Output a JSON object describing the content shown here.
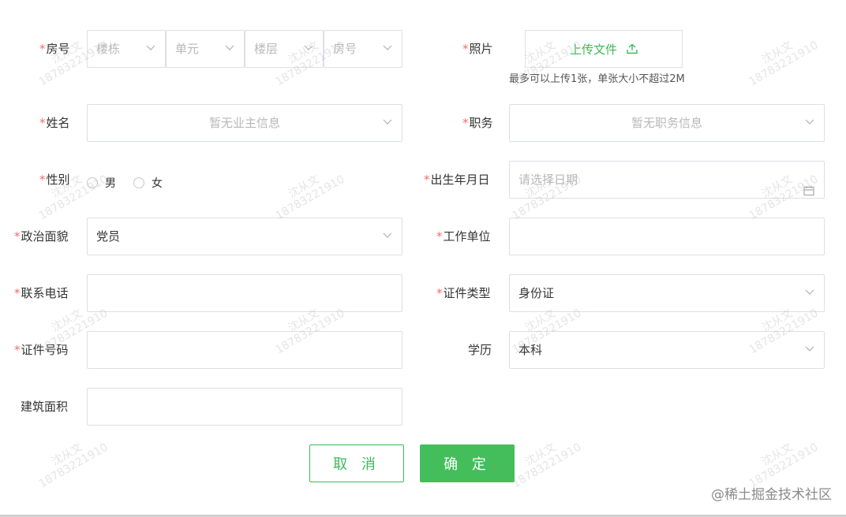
{
  "form": {
    "room": {
      "label": "房号",
      "required": "*",
      "selects": [
        {
          "placeholder": "楼栋"
        },
        {
          "placeholder": "单元"
        },
        {
          "placeholder": "楼层"
        },
        {
          "placeholder": "房号"
        }
      ]
    },
    "photo": {
      "label": "照片",
      "required": "*",
      "upload_label": "上传文件",
      "hint": "最多可以上传1张，单张大小不超过2M"
    },
    "name": {
      "label": "姓名",
      "required": "*",
      "placeholder": "暂无业主信息"
    },
    "position": {
      "label": "职务",
      "required": "*",
      "placeholder": "暂无职务信息"
    },
    "gender": {
      "label": "性别",
      "required": "*",
      "options": [
        "男",
        "女"
      ]
    },
    "birthday": {
      "label": "出生年月日",
      "required": "*",
      "placeholder": "请选择日期"
    },
    "politics": {
      "label": "政治面貌",
      "required": "*",
      "value": "党员"
    },
    "workplace": {
      "label": "工作单位",
      "required": "*",
      "value": ""
    },
    "phone": {
      "label": "联系电话",
      "required": "*",
      "value": ""
    },
    "id_type": {
      "label": "证件类型",
      "required": "*",
      "value": "身份证"
    },
    "id_number": {
      "label": "证件号码",
      "required": "*",
      "value": ""
    },
    "education": {
      "label": "学历",
      "value": "本科"
    },
    "area": {
      "label": "建筑面积",
      "value": ""
    }
  },
  "buttons": {
    "cancel": "取 消",
    "ok": "确 定"
  },
  "watermark": {
    "name": "沈从文",
    "number": "18783221910"
  },
  "footer": "@稀土掘金技术社区",
  "colors": {
    "accent": "#3fb85a",
    "required": "#f56c6c",
    "border": "#dcdfe6"
  }
}
